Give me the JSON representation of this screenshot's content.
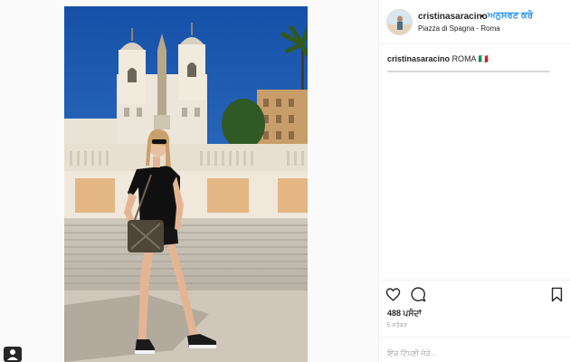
{
  "post": {
    "username": "cristinasaracino",
    "separator": "•",
    "follow_label": "ਅਨੁਸਰਣ ਕਰੋ",
    "location": "Piazza di Spagna - Roma",
    "caption_username": "cristinasaracino",
    "caption_text": "ROMA 🇮🇹",
    "likes": "488 ਪਸੰਦਾਂ",
    "time_ago": "5 ਸਤੰਬਰ",
    "comment_placeholder": "ਇੱਕ ਟਿੱਪਣੀ ਜੋੜੋ..."
  },
  "icons": {
    "like": "heart-icon",
    "comment": "comment-icon",
    "save": "bookmark-icon",
    "corner": "user-badge-icon"
  },
  "colors": {
    "follow": "#3897f0",
    "sky": "#1d5fb8",
    "text": "#262626"
  }
}
